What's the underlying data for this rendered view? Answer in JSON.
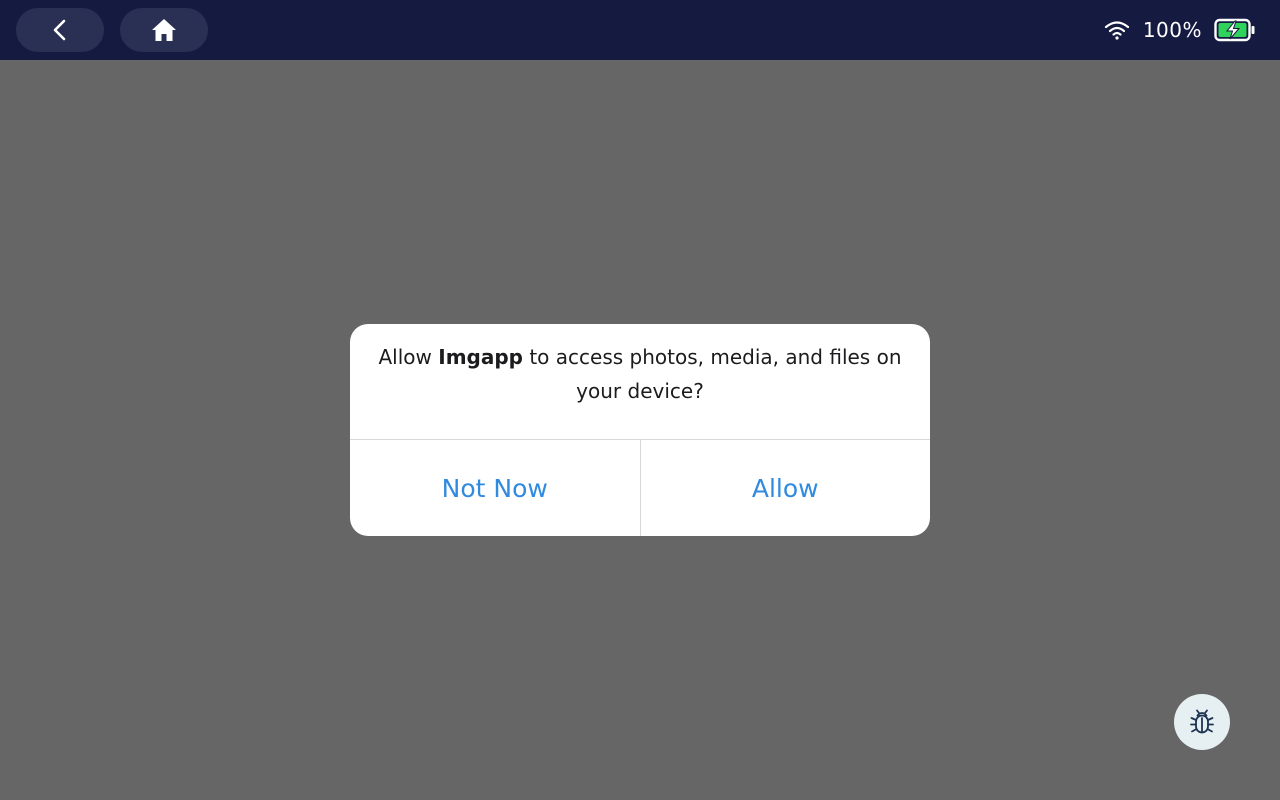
{
  "status_bar": {
    "battery_percent": "100%",
    "icons": [
      "wifi-icon",
      "battery-charging-icon"
    ]
  },
  "nav": {
    "back_icon": "chevron-left-icon",
    "home_icon": "home-icon"
  },
  "dialog": {
    "message_prefix": "Allow ",
    "app_name": "Imgapp",
    "message_suffix": " to access photos, media, and files on your device?",
    "deny_label": "Not Now",
    "allow_label": "Allow"
  },
  "fab": {
    "icon": "bug-icon"
  },
  "colors": {
    "topbar": "#141a40",
    "overlay": "#666666",
    "accent": "#2f8ae0",
    "battery": "#2fd35a"
  }
}
